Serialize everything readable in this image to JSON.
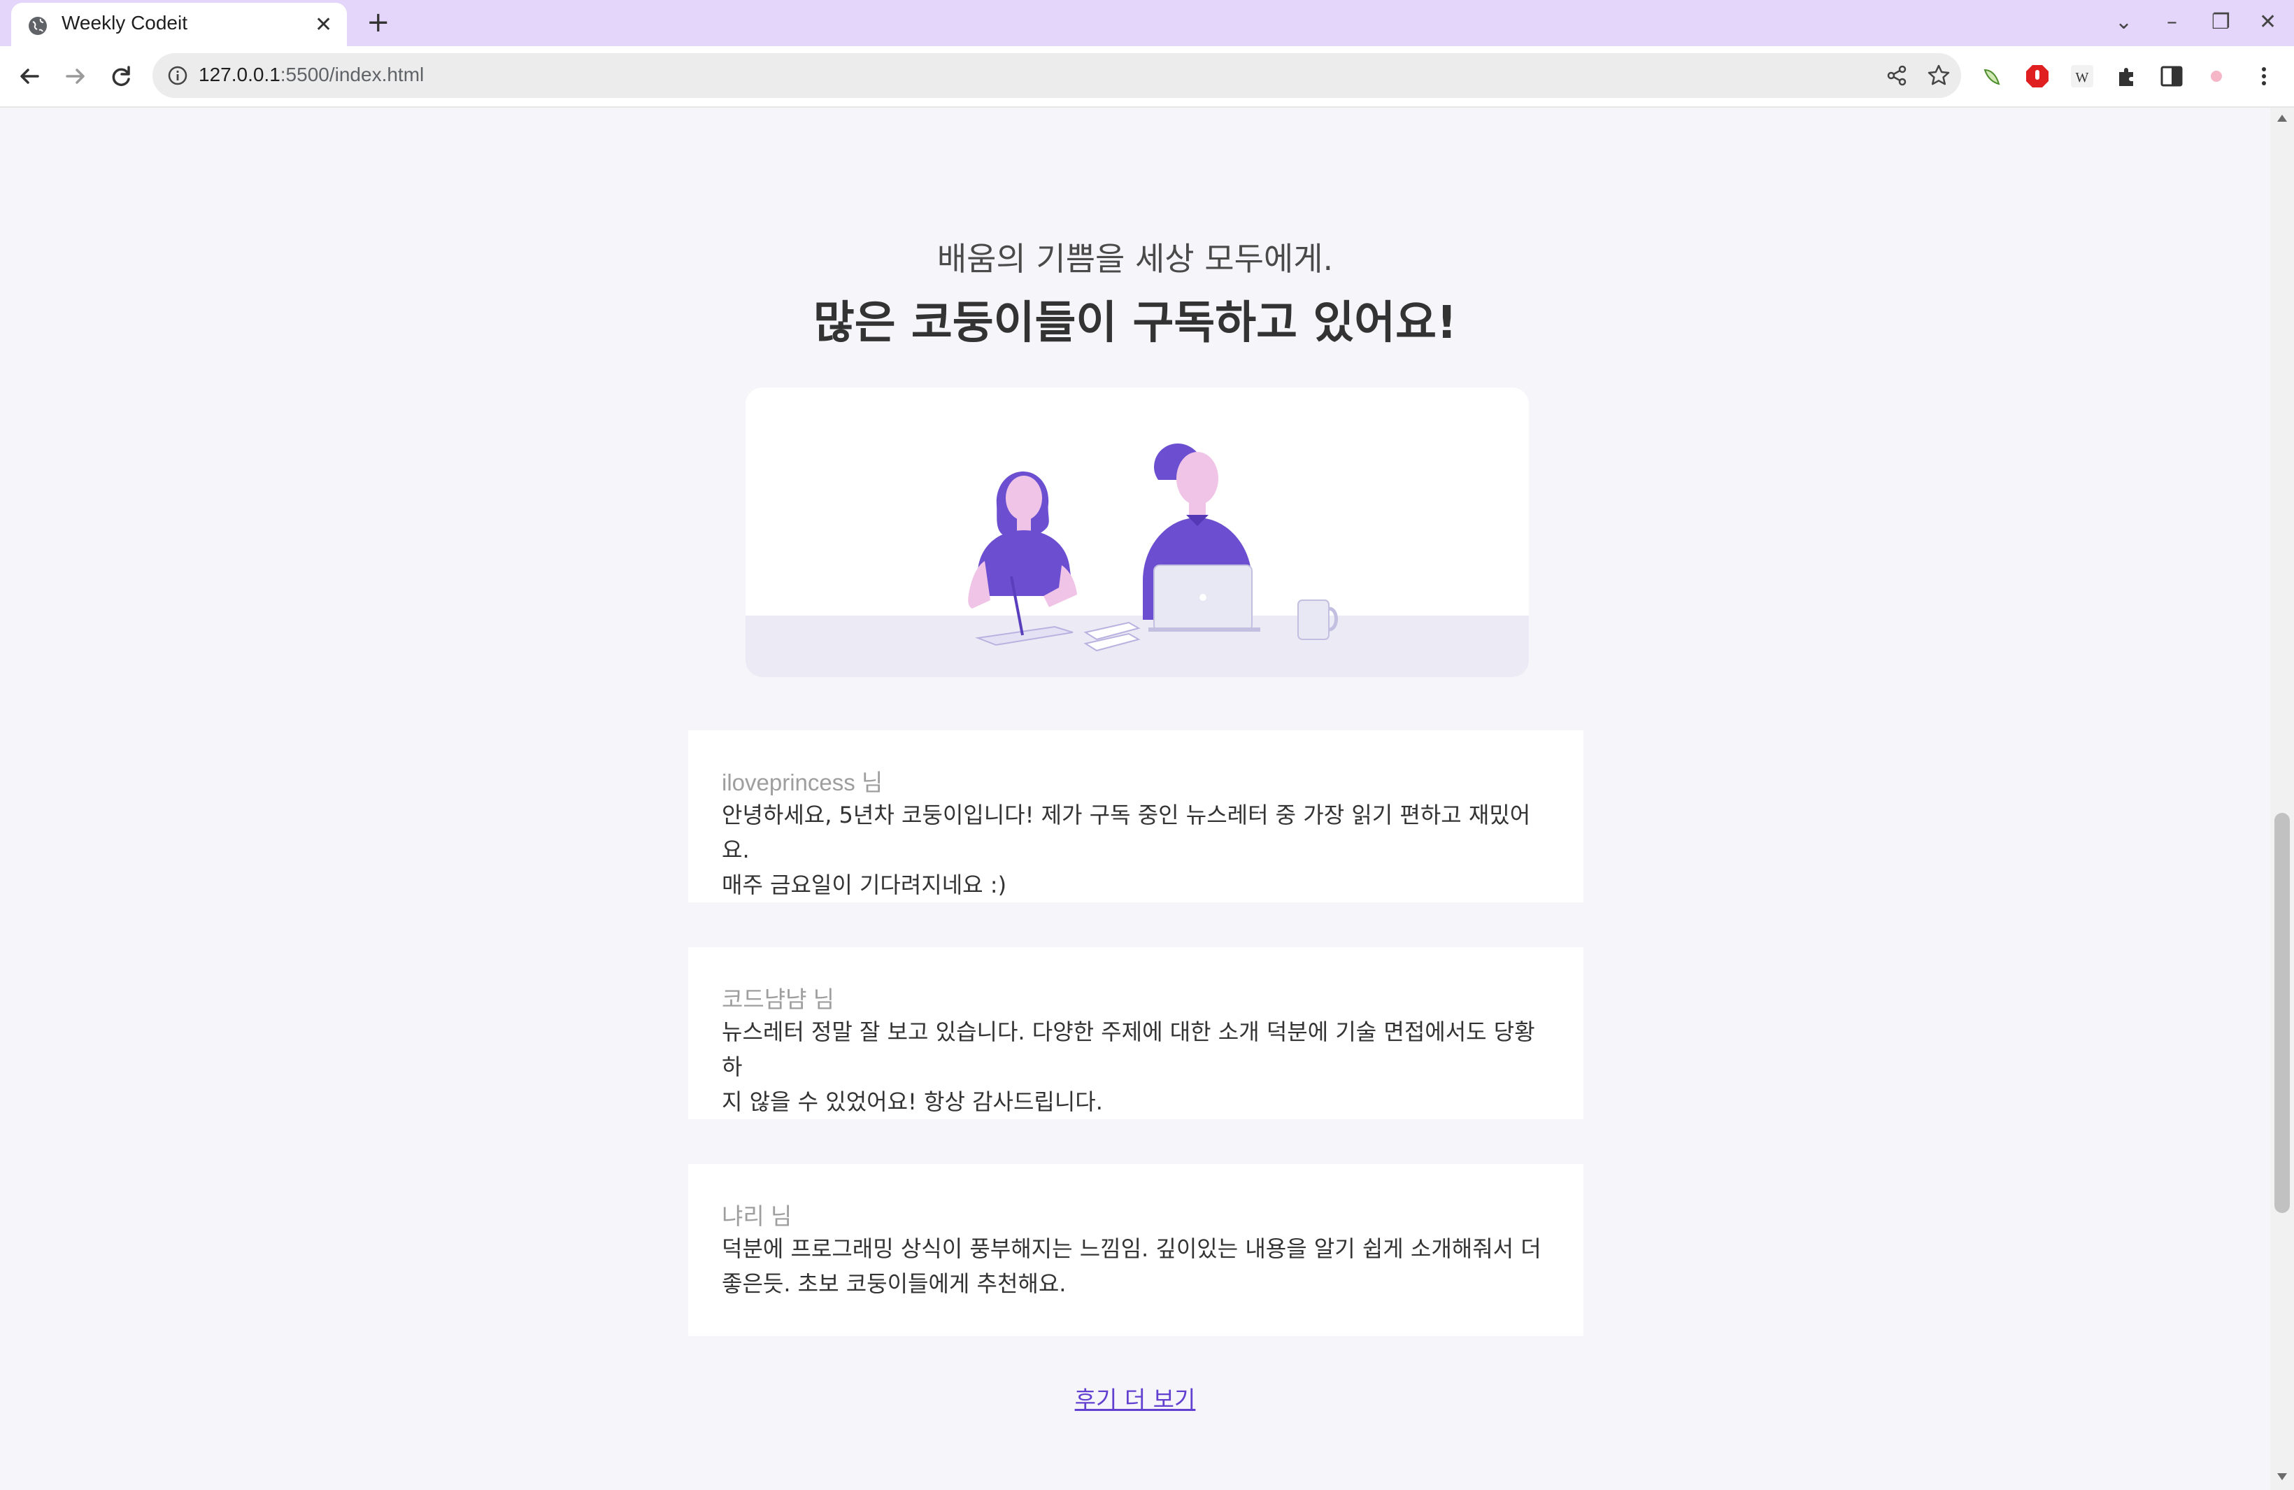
{
  "browser": {
    "tab_title": "Weekly Codeit",
    "url_host": "127.0.0.1",
    "url_rest": ":5500/index.html"
  },
  "section": {
    "subtitle": "배움의 기쁨을 세상 모두에게.",
    "headline": "많은 코둥이들이 구독하고 있어요!"
  },
  "reviews": [
    {
      "name": "iloveprincess 님",
      "lines": [
        "안녕하세요, 5년차 코둥이입니다! 제가 구독 중인 뉴스레터 중 가장 읽기 편하고 재밌어요.",
        "매주 금요일이 기다려지네요 :)"
      ]
    },
    {
      "name": "코드냠냠 님",
      "lines": [
        "뉴스레터 정말 잘 보고 있습니다. 다양한 주제에 대한 소개 덕분에 기술 면접에서도 당황하",
        "지 않을 수 있었어요! 항상 감사드립니다."
      ]
    },
    {
      "name": "냐리 님",
      "lines": [
        "덕분에 프로그래밍 상식이 풍부해지는 느낌임. 깊이있는 내용을 알기 쉽게 소개해줘서 더",
        "좋은듯. 초보 코둥이들에게 추천해요."
      ]
    }
  ],
  "more_reviews_label": "후기 더 보기",
  "colors": {
    "accent": "#6241d1",
    "illustration_purple": "#6c4fd0",
    "skin": "#f0c4e6",
    "page_bg": "#f6f5fa",
    "tabstrip_bg": "#e4d6fa"
  },
  "icons": [
    "globe-icon",
    "close-icon",
    "plus-icon",
    "back-arrow-icon",
    "forward-arrow-icon",
    "reload-icon",
    "info-icon",
    "share-icon",
    "star-icon",
    "puzzle-icon",
    "side-panel-icon",
    "kebab-menu-icon"
  ]
}
